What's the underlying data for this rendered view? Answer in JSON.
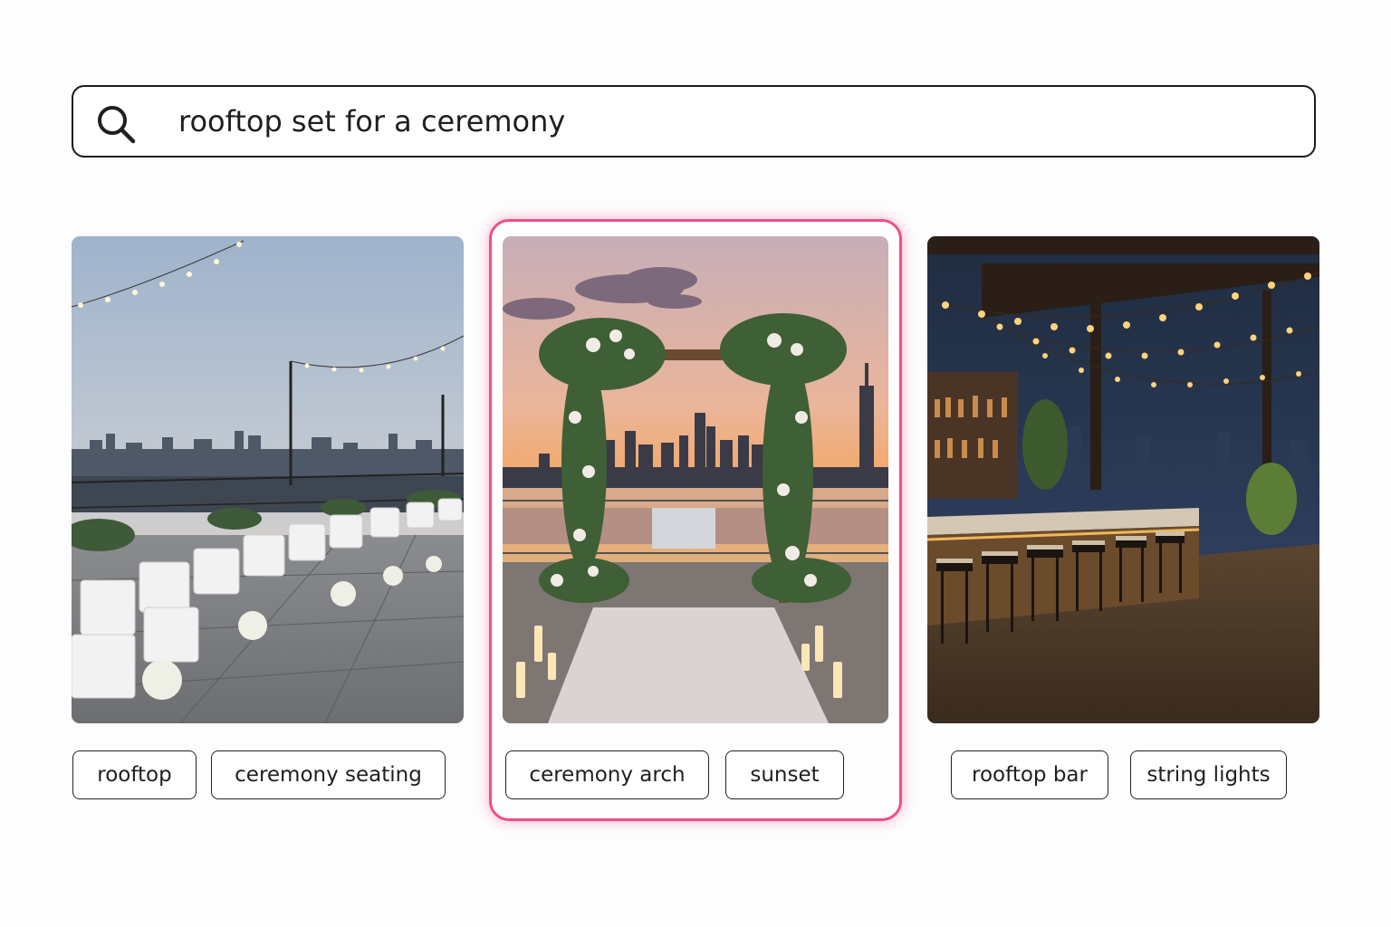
{
  "search": {
    "query": "rooftop set for a ceremony",
    "icon": "search-icon"
  },
  "results": [
    {
      "name": "rooftop ceremony seating",
      "selected": false,
      "tags": [
        "rooftop",
        "ceremony seating"
      ]
    },
    {
      "name": "ceremony arch at sunset",
      "selected": true,
      "tags": [
        "ceremony arch",
        "sunset"
      ]
    },
    {
      "name": "rooftop bar with string lights",
      "selected": false,
      "tags": [
        "rooftop bar",
        "string lights"
      ]
    }
  ],
  "colors": {
    "selection": "#ef4f8a",
    "border": "#1b1b1b"
  }
}
